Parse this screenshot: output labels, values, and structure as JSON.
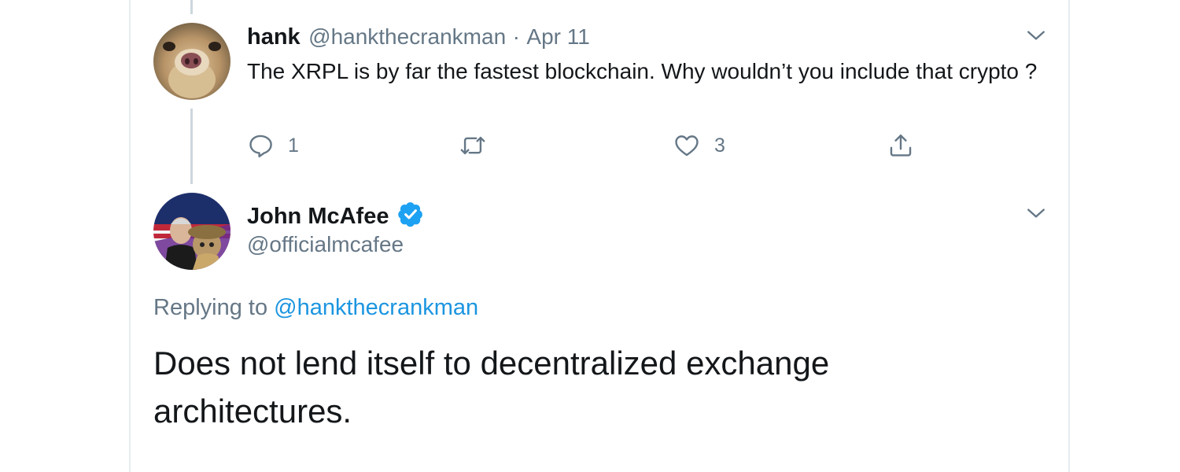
{
  "reply_tweet": {
    "name": "hank",
    "handle": "@hankthecrankman",
    "separator": "·",
    "date": "Apr 11",
    "text": "The XRPL is by far the fastest blockchain. Why wouldn’t you include that crypto ?",
    "reply_count": "1",
    "like_count": "3",
    "icons": [
      "reply-icon",
      "retweet-icon",
      "like-icon",
      "share-icon",
      "chevron-down-icon"
    ]
  },
  "main_tweet": {
    "name": "John McAfee",
    "handle": "@officialmcafee",
    "verified": true,
    "replying_prefix": "Replying to",
    "replying_handle": "@hankthecrankman",
    "text": "Does not lend itself to decentralized exchange architectures.",
    "icons": [
      "verified-badge-icon",
      "chevron-down-icon"
    ]
  },
  "colors": {
    "link_blue": "#1b95e0",
    "verified_blue": "#1da1f2",
    "secondary_text": "#657786",
    "primary_text": "#14171a",
    "thread_line": "#ccd6dd",
    "border": "#e6ecf0"
  }
}
